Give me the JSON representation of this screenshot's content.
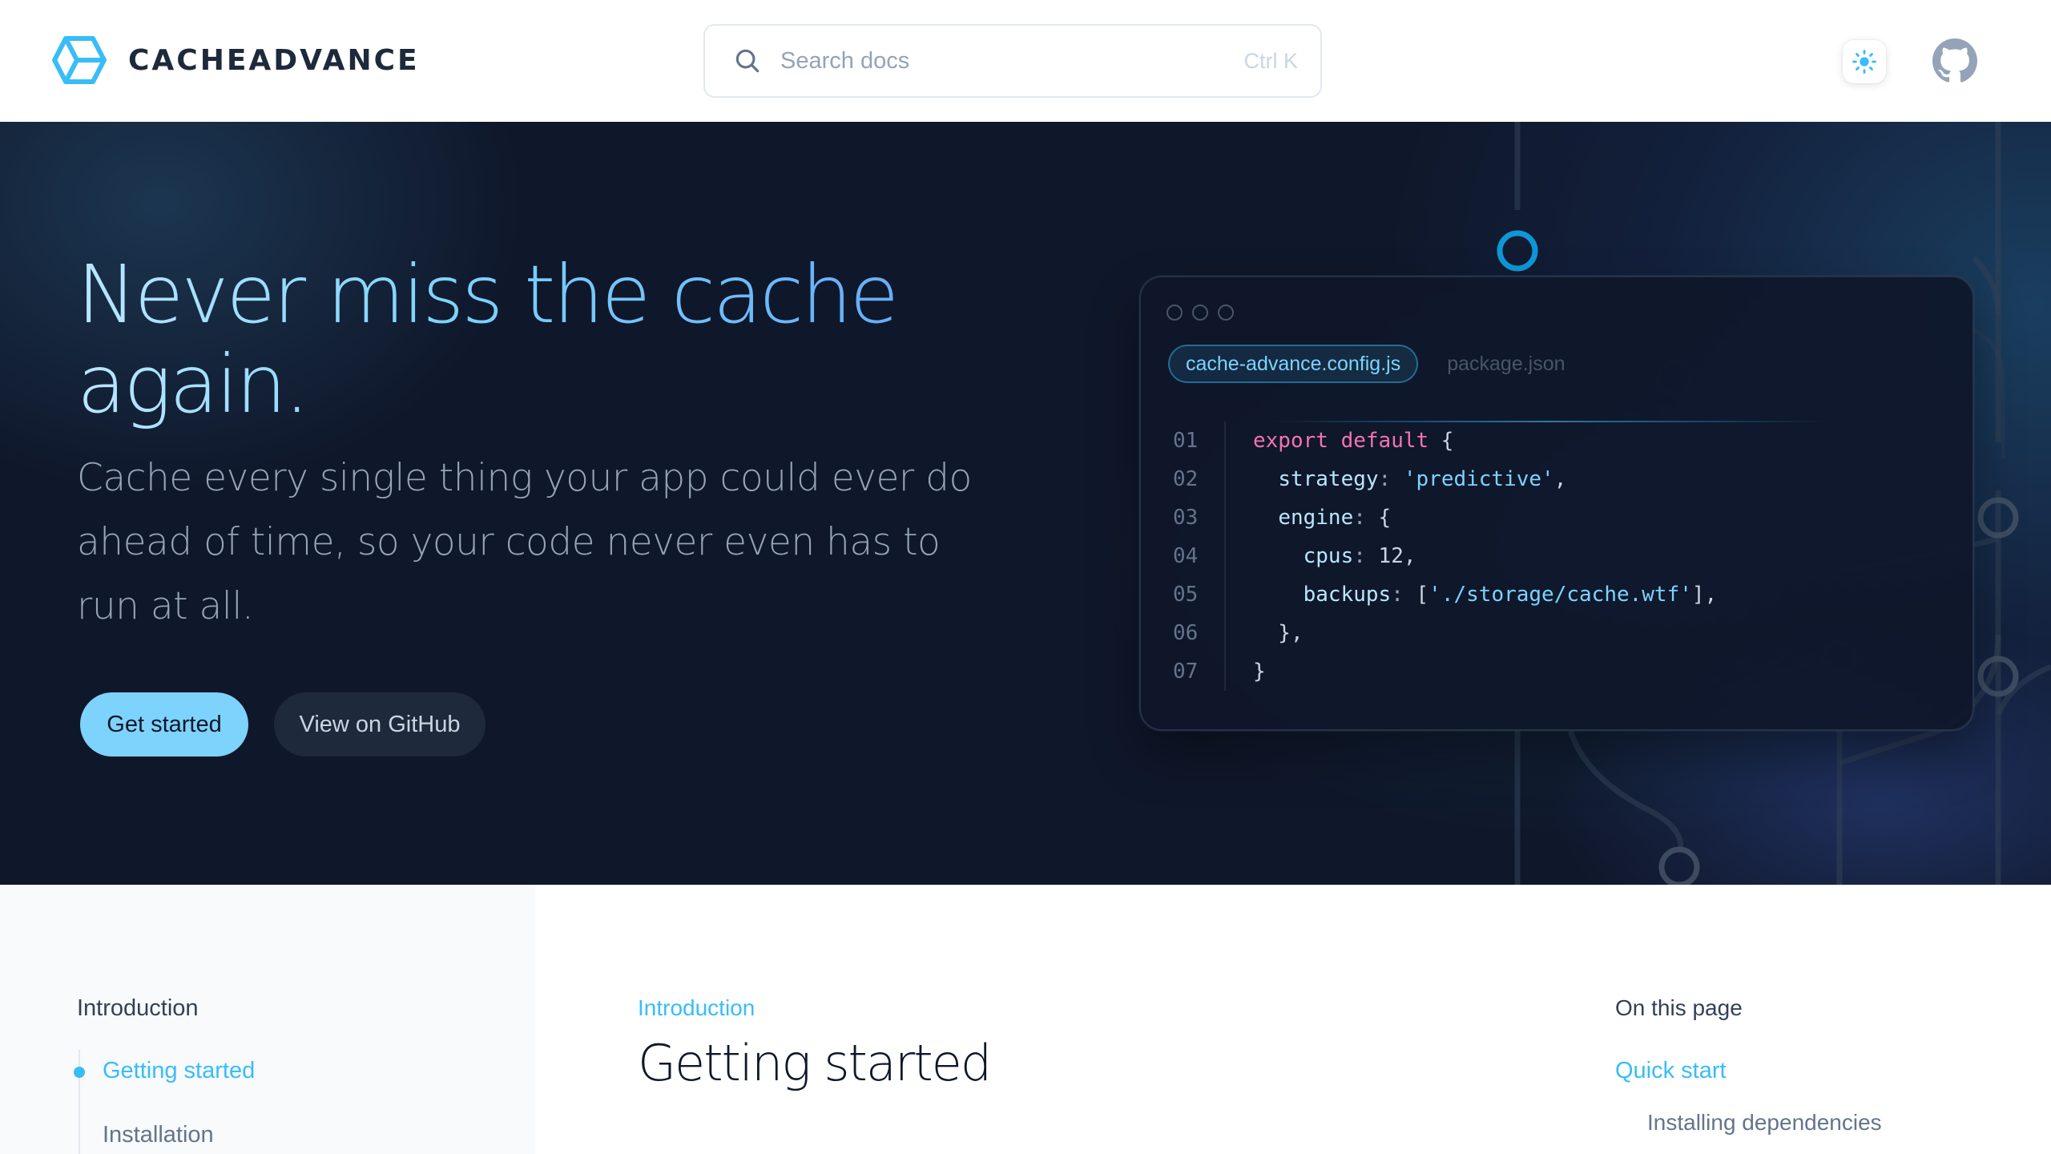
{
  "header": {
    "logo_text": "CACHEADVANCE",
    "search_placeholder": "Search docs",
    "search_shortcut": "Ctrl K",
    "theme_icon": "sun-icon",
    "github_icon": "github-icon"
  },
  "hero": {
    "title": "Never miss the cache again.",
    "subtitle": "Cache every single thing your app could ever do ahead of time, so your code never even has to run at all.",
    "primary_button": "Get started",
    "secondary_button": "View on GitHub"
  },
  "code_window": {
    "tabs": [
      "cache-advance.config.js",
      "package.json"
    ],
    "active_tab": "cache-advance.config.js",
    "line_numbers": [
      "01",
      "02",
      "03",
      "04",
      "05",
      "06",
      "07"
    ],
    "lines": [
      "export default {",
      "  strategy: 'predictive',",
      "  engine: {",
      "    cpus: 12,",
      "    backups: ['./storage/cache.wtf'],",
      "  },",
      "}"
    ]
  },
  "sidebar": {
    "section": "Introduction",
    "items": [
      {
        "label": "Getting started",
        "active": true
      },
      {
        "label": "Installation",
        "active": false
      }
    ]
  },
  "main": {
    "breadcrumb": "Introduction",
    "title": "Getting started"
  },
  "toc": {
    "heading": "On this page",
    "items": [
      {
        "label": "Quick start",
        "active": true
      },
      {
        "label": "Installing dependencies",
        "active": false
      }
    ]
  },
  "colors": {
    "accent": "#38bdf8",
    "hero_bg": "#0f172a",
    "primary_button": "#7dd3fc"
  }
}
